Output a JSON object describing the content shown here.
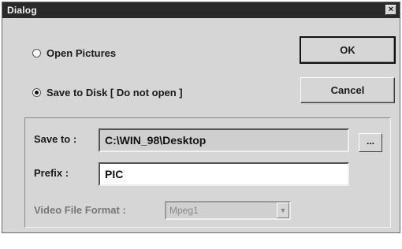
{
  "window": {
    "title": "Dialog",
    "close_label": "×"
  },
  "options": {
    "open_pictures": {
      "label": "Open Pictures",
      "checked": false
    },
    "save_to_disk": {
      "label": "Save to Disk [ Do not open ]",
      "checked": true
    }
  },
  "buttons": {
    "ok": "OK",
    "cancel": "Cancel",
    "browse": "..."
  },
  "form": {
    "save_to_label": "Save to :",
    "save_to_value": "C:\\WIN_98\\Desktop",
    "prefix_label": "Prefix :",
    "prefix_value": "PIC",
    "video_format_label": "Video File Format :",
    "video_format_value": "Mpeg1",
    "dropdown_icon": "chevron-down-icon"
  }
}
